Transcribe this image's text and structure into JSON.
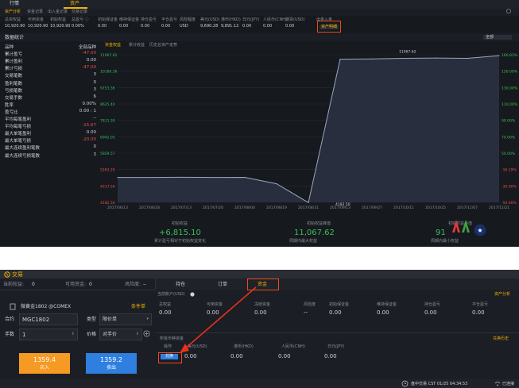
{
  "top": {
    "tabs": [
      "行情",
      "资产"
    ],
    "subtabs": [
      "资产分析",
      "资金记录",
      "出入金记录",
      "交易记录"
    ],
    "summary": {
      "headers": [
        "总资权益",
        "可用资金",
        "初始权益",
        "总盈亏 ⓘ",
        "初始保证金",
        "维持保证金",
        "持仓盈亏",
        "平仓盈亏",
        "风险程度",
        "美元(USD)",
        "港币(HKD)",
        "日元(JPY)",
        "人民币(CNH)",
        "期货(USD)",
        "出金入金"
      ],
      "values": [
        "10,920.90",
        "10,920.90",
        "10,920.90",
        "0.00%",
        "0.00",
        "0.00",
        "0.00",
        "0.00",
        "USD",
        "9,690.28",
        "9,891.12",
        "0.00",
        "0.00",
        "0.00"
      ],
      "action_label": "资产明细"
    },
    "stats_title": "数据统计",
    "stats_select": "全部品种",
    "stats": [
      {
        "label": "品种",
        "value": "全部品种"
      },
      {
        "label": "累计盈亏",
        "value": "-47.00"
      },
      {
        "label": "累计盈利",
        "value": "0.00"
      },
      {
        "label": "累计亏损",
        "value": "-47.00"
      },
      {
        "label": "交易笔数",
        "value": "3"
      },
      {
        "label": "盈利笔数",
        "value": "0"
      },
      {
        "label": "亏损笔数",
        "value": "3"
      },
      {
        "label": "交易手数",
        "value": "6"
      },
      {
        "label": "胜率",
        "value": "0.00%"
      },
      {
        "label": "盈亏比",
        "value": "0.00 : 1"
      },
      {
        "label": "平均每笔盈利",
        "value": "--"
      },
      {
        "label": "平均每笔亏损",
        "value": "-15.67"
      },
      {
        "label": "最大单笔盈利",
        "value": "0.00"
      },
      {
        "label": "最大单笔亏损",
        "value": "-20.00"
      },
      {
        "label": "最大连续盈利笔数",
        "value": "0"
      },
      {
        "label": "最大连续亏损笔数",
        "value": "3"
      }
    ],
    "chart_tabs": [
      "资金权益",
      "累计收益",
      "历史总资产走势"
    ],
    "period_select": "全部",
    "bottom_metrics": [
      {
        "label": "初始权益",
        "value": "+6,815.10",
        "sub": "累计盈亏相对于初始权益变化"
      },
      {
        "label": "初始权益峰值",
        "value": "11,067.62",
        "sub": "周期内最大权益"
      },
      {
        "label": "初始权益谷值",
        "value": "91",
        "sub": "周期内最小权益"
      }
    ]
  },
  "chart_data": {
    "type": "line",
    "x": [
      "2017/06/13",
      "2017/06/28",
      "2017/07/13",
      "2017/07/20",
      "2017/08/04",
      "2017/08/19",
      "2017/08/31",
      "2017/09/13",
      "2017/09/27",
      "2017/10/11",
      "2017/10/25",
      "2017/11/07",
      "2017/11/21"
    ],
    "series": [
      {
        "values": [
          5280,
          5280,
          5285,
          5280,
          5282,
          4980,
          4090,
          10870,
          10880,
          10910,
          10925,
          10910,
          11040
        ]
      }
    ],
    "ylim": [
      4100,
      11080
    ],
    "ylabels_left": [
      "11067.62",
      "10180.36",
      "9753.36",
      "8625.40",
      "7811.30",
      "6942.05",
      "5929.57",
      "5263.29",
      "4517.56",
      "4182.50"
    ],
    "ylabels_right": [
      "166.83%",
      "150.00%",
      "130.00%",
      "110.00%",
      "90.00%",
      "70.00%",
      "50.00%",
      "-16.19%",
      "-30.00%",
      "-50.00%"
    ],
    "annotations": [
      {
        "x": "2017/10/11",
        "label": "11067.62"
      },
      {
        "x": "2017/09/13",
        "label": "4182.50"
      }
    ],
    "colors": {
      "line": "#9aa7bd",
      "fill": "#2a3140"
    }
  },
  "bottom": {
    "title": "交易",
    "header": {
      "rights_label": "当前权益:",
      "rights_value": "0",
      "available_label": "可用资金:",
      "available_value": "0",
      "risk_label": "风险度:",
      "risk_value": "--"
    },
    "tabs": [
      "持仓",
      "订单",
      "资金"
    ],
    "account_tab": "资产分析",
    "instrument": "微黄金1802 @COMEX",
    "condition_btn": "条件单",
    "contract_label": "合约",
    "contract_value": "MGC1802",
    "type_label": "类型",
    "type_value": "限价单",
    "qty_label": "手数",
    "qty_value": "1",
    "price_label": "价格",
    "price_value": "对手价",
    "buy_price": "1359.4",
    "buy_label": "买入",
    "sell_price": "1359.2",
    "sell_label": "卖出",
    "account": {
      "title": "当前账户(USD)",
      "headers": [
        "总权益",
        "可用资金",
        "冻结资金",
        "风险度",
        "初始保证金",
        "维持保证金",
        "持仓盈亏",
        "平仓盈亏"
      ],
      "values": [
        "0.00",
        "0.00",
        "0.00",
        "--",
        "0.00",
        "0.00",
        "0.00",
        "0.00"
      ]
    },
    "currencies": {
      "title": "所有币种资金",
      "history": "兑换历史",
      "headers": [
        "操作",
        "美元(USD)",
        "港币(HKD)",
        "人民币(CNH)",
        "日元(JPY)"
      ],
      "action": "兑换",
      "values": [
        "0.00",
        "0.00",
        "0.00",
        "0.00"
      ]
    },
    "status": {
      "market": "盘中交易 CST  01/25 04:34:53",
      "connection": "已连接"
    },
    "colors": {
      "buy": "#f59a23",
      "sell": "#2f7fe0",
      "accent": "#f0b400"
    }
  }
}
